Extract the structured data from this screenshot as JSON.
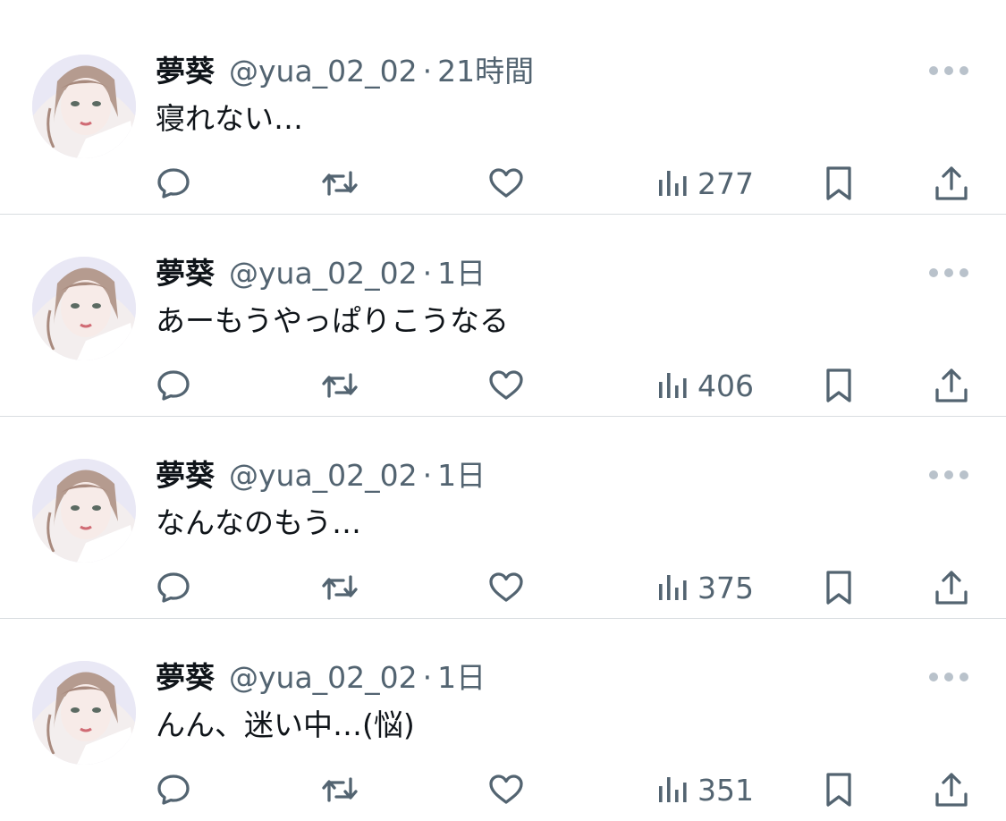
{
  "colors": {
    "secondary": "#536471",
    "divider": "#d9dde1",
    "more_dots": "#b9c2cb"
  },
  "tweets": [
    {
      "name": "夢葵",
      "handle": "@yua_02_02",
      "dot": "·",
      "time": "21時間",
      "text": "寝れない…",
      "views": "277"
    },
    {
      "name": "夢葵",
      "handle": "@yua_02_02",
      "dot": "·",
      "time": "1日",
      "text": "あーもうやっぱりこうなる",
      "views": "406"
    },
    {
      "name": "夢葵",
      "handle": "@yua_02_02",
      "dot": "·",
      "time": "1日",
      "text": "なんなのもう…",
      "views": "375"
    },
    {
      "name": "夢葵",
      "handle": "@yua_02_02",
      "dot": "·",
      "time": "1日",
      "text": "んん、迷い中…(悩)",
      "views": "351"
    }
  ],
  "icons": {
    "more": "more-horizontal-icon",
    "reply": "reply-bubble-icon",
    "retweet": "retweet-icon",
    "like": "heart-icon",
    "views": "views-chart-icon",
    "bookmark": "bookmark-icon",
    "share": "share-upload-icon"
  }
}
